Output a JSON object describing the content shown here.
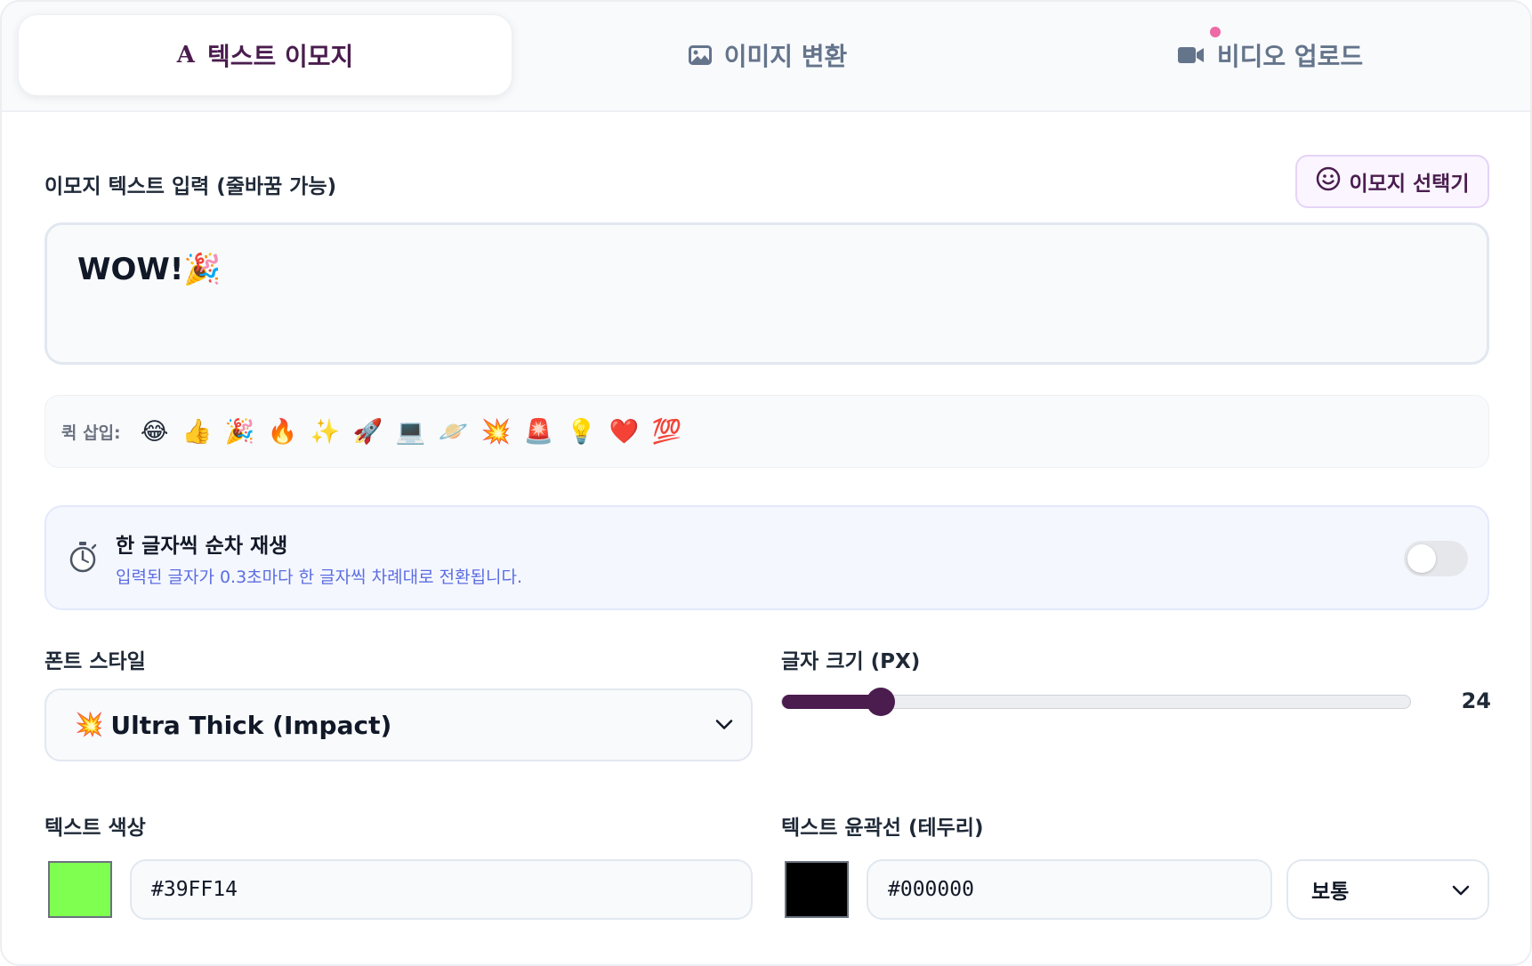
{
  "tabs": [
    {
      "label": "텍스트 이모지",
      "icon": "text-a-icon",
      "active": true
    },
    {
      "label": "이미지 변환",
      "icon": "image-icon",
      "active": false
    },
    {
      "label": "비디오 업로드",
      "icon": "video-camera-icon",
      "active": false
    }
  ],
  "tab_a_glyph": "A",
  "input": {
    "label": "이모지 텍스트 입력 (줄바꿈 가능)",
    "value": "WOW!🎉",
    "picker_label": "이모지 선택기"
  },
  "quick_insert": {
    "label": "퀵 삽입:",
    "emojis": [
      "😂",
      "👍",
      "🎉",
      "🔥",
      "✨",
      "🚀",
      "💻",
      "🪐",
      "💥",
      "🚨",
      "💡",
      "❤️",
      "💯"
    ]
  },
  "sequential": {
    "icon": "stopwatch-icon",
    "title": "한 글자씩 순차 재생",
    "description": "입력된 글자가 0.3초마다 한 글자씩 차례대로 전환됩니다.",
    "enabled": false
  },
  "font_style": {
    "label": "폰트 스타일",
    "emoji": "💥",
    "selected": "Ultra Thick (Impact)"
  },
  "font_size": {
    "label": "글자 크기 (PX)",
    "value": "24",
    "fill_fraction": 0.158
  },
  "text_color": {
    "label": "텍스트 색상",
    "value": "#39FF14",
    "swatch_color": "#7fff4f"
  },
  "outline_color": {
    "label": "텍스트 윤곽선 (테두리)",
    "value": "#000000",
    "swatch_color": "#000000",
    "thickness": "보통"
  },
  "colors": {
    "accent": "#4a1d4e",
    "notify_dot": "#ec6aa6",
    "description_text": "#5b6ee1"
  }
}
